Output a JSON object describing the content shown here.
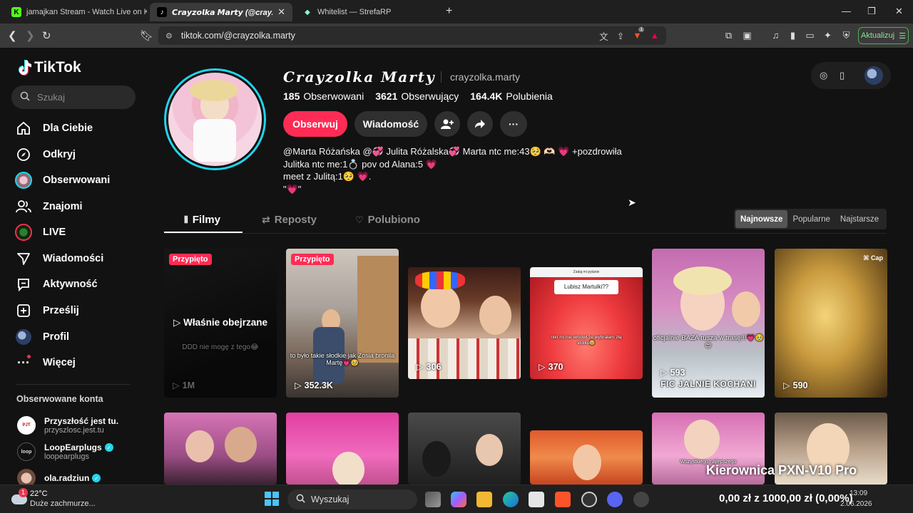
{
  "browser": {
    "tabs": [
      {
        "title": "jamajkan Stream - Watch Live on Kick",
        "fav": "K"
      },
      {
        "title": "𝘾𝙧𝙖𝙮𝙯𝙤𝙡𝙠𝙖 𝙈𝙖𝙧𝙩𝙮 (@crayzo",
        "fav": "♪"
      },
      {
        "title": "Whitelist — StrefaRP",
        "fav": "◆"
      }
    ],
    "url": "tiktok.com/@crayzolka.marty",
    "update_label": "Aktualizuj",
    "brave_badge": "1"
  },
  "sidebar": {
    "logo": "TikTok",
    "search_placeholder": "Szukaj",
    "items": [
      {
        "label": "Dla Ciebie",
        "icon": "home-icon"
      },
      {
        "label": "Odkryj",
        "icon": "compass-icon"
      },
      {
        "label": "Obserwowani",
        "icon": "following-avatar-icon"
      },
      {
        "label": "Znajomi",
        "icon": "friends-icon"
      },
      {
        "label": "LIVE",
        "icon": "live-icon"
      },
      {
        "label": "Wiadomości",
        "icon": "messages-icon"
      },
      {
        "label": "Aktywność",
        "icon": "activity-icon"
      },
      {
        "label": "Prześlij",
        "icon": "upload-icon"
      },
      {
        "label": "Profil",
        "icon": "profile-icon"
      },
      {
        "label": "Więcej",
        "icon": "more-icon"
      }
    ],
    "following_header": "Obserwowane konta",
    "accounts": [
      {
        "name": "Przyszłość jest tu.",
        "handle": "przyszlosc.jest.tu",
        "verified": false,
        "avatar_text": "PJT"
      },
      {
        "name": "LoopEarplugs",
        "handle": "loopearplugs",
        "verified": true,
        "avatar_text": "loop"
      },
      {
        "name": "ola.radziun",
        "handle": "",
        "verified": true,
        "avatar_text": ""
      }
    ]
  },
  "profile": {
    "display_name": "Crayzolka Marty",
    "username": "crayzolka.marty",
    "stats": [
      {
        "value": "185",
        "label": "Obserwowani"
      },
      {
        "value": "3621",
        "label": "Obserwujący"
      },
      {
        "value": "164.4K",
        "label": "Polubienia"
      }
    ],
    "follow_label": "Obserwuj",
    "message_label": "Wiadomość",
    "bio_lines": [
      "@Marta Różańska @💞 Julita Różalska💞 Marta ntc me:43🥺 🫶🏻 💗 +pozdrowiła",
      "Julitka ntc me:1💍 pov od Alana:5 💗",
      "meet z Julitą:1🥺 💗.",
      "\"💗\""
    ]
  },
  "tabs": {
    "videos": "Filmy",
    "reposts": "Reposty",
    "liked": "Polubiono"
  },
  "sort": [
    "Najnowsze",
    "Popularne",
    "Najstarsze"
  ],
  "videos": [
    {
      "pinned": "Przypięto",
      "views": "1M",
      "caption": "DDD nie mogę z tego😂",
      "overlay": "Właśnie obejrzane"
    },
    {
      "pinned": "Przypięto",
      "views": "352.3K",
      "caption": "to było takie słodkie jak Zosia bronila Martę💗🥹"
    },
    {
      "views": "306",
      "caption": ""
    },
    {
      "views": "370",
      "caption": "nikt mi nie wmówi że wybrałam złą idolkę🥹",
      "top_text": "Lubisz Martulki??"
    },
    {
      "views": "593",
      "caption": "oficjalnie BAZA rusza w trasę!!!💗🥹😍",
      "bottom_text": "FIC JALNIE KOCHANI"
    },
    {
      "views": "590",
      "caption": "",
      "brand": "Cap"
    }
  ],
  "overlay_text": "Kierownica PXN-V10 Pro",
  "taskbar": {
    "weather_temp": "22°C",
    "weather_desc": "Duże zachmurze...",
    "search_label": "Wyszukaj",
    "ticker": "0,00 zł z 1000,00 zł (0,00%)",
    "time": "13:09",
    "date": "2.06.2026"
  }
}
